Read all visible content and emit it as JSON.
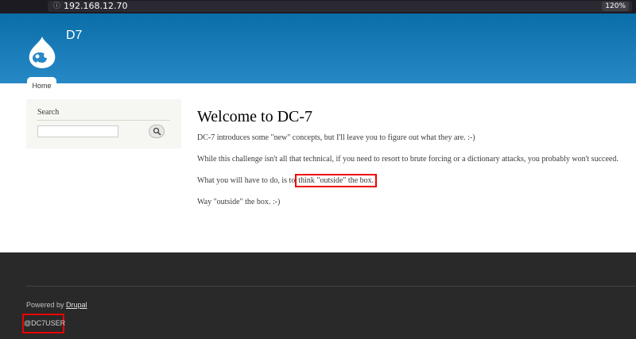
{
  "browser": {
    "url": "192.168.12.70",
    "zoom": "120%"
  },
  "header": {
    "site_name": "D7",
    "tabs": [
      {
        "label": "Home"
      }
    ]
  },
  "sidebar": {
    "search_title": "Search",
    "search_value": ""
  },
  "main": {
    "title": "Welcome to DC-7",
    "para1": "DC-7 introduces some \"new\" concepts, but I'll leave you to figure out what they are.  :-)",
    "para2": "While this challenge isn't all that technical, if you need to resort to brute forcing or a dictionary attacks, you probably won't succeed.",
    "para3_pre": "What you will have to do, is to",
    "para3_hl": "think \"outside\" the box.",
    "para4": "Way \"outside\" the box.  :-)"
  },
  "footer": {
    "powered_prefix": "Powered by ",
    "powered_link": "Drupal",
    "user_label": "@DC7USER"
  },
  "colors": {
    "header_top": "#0a6ea8",
    "header_bottom": "#2788c6",
    "highlight_border": "#e00000",
    "footer_bg": "#292929"
  }
}
